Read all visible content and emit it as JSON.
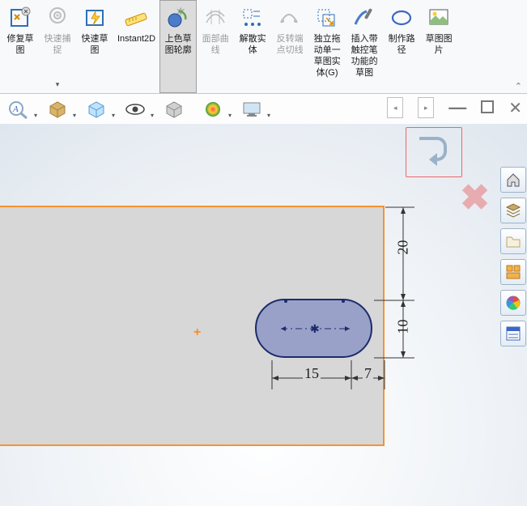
{
  "ribbon": {
    "repair_sketch": "修复草\n图",
    "quick_snap": "快速捕\n捉",
    "quick_sketch": "快速草\n图",
    "instant2d": "Instant2D",
    "shaded_contour": "上色草\n图轮廓",
    "face_curve": "面部曲\n线",
    "dissolve": "解散实\n体",
    "reverse_tangent": "反转端\n点切线",
    "independent_drag": "独立拖\n动单一\n草图实\n体(G)",
    "insert_stylus": "插入带\n触控笔\n功能的\n草图",
    "make_path": "制作路\n径",
    "sketch_picture": "草图图\n片"
  },
  "dims": {
    "d1": "20",
    "d2": "10",
    "d3": "15",
    "d4": "7"
  },
  "icons": {
    "repair": "repair",
    "target": "target",
    "bolt": "bolt",
    "ruler": "ruler",
    "blue_solid": "blue_solid",
    "mesh": "mesh",
    "dissolve": "dissolve",
    "tangent": "tangent",
    "drag_one": "drag_one",
    "stylus": "stylus",
    "path": "path",
    "picture": "picture"
  }
}
